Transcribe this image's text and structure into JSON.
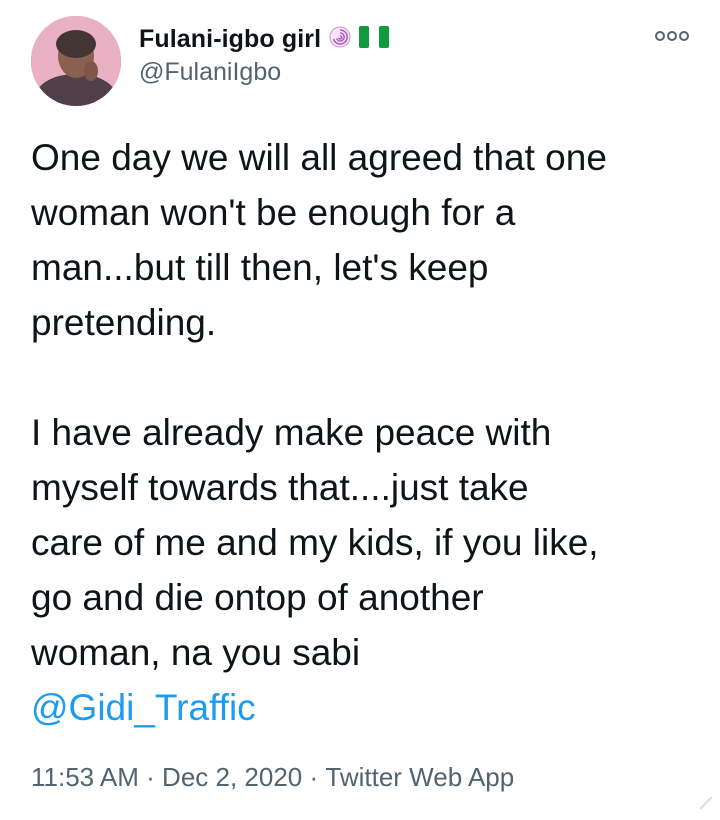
{
  "author": {
    "display_name": "Fulani-igbo girl",
    "handle": "@FulaniIgbo",
    "badges": [
      "cyclone-emoji-icon",
      "nigeria-flag-icon"
    ]
  },
  "tweet": {
    "paragraph_1": "One day we will all agreed that one\nwoman won't be enough for a\nman...but till then, let's keep\npretending.",
    "paragraph_2": "I have already make peace with\nmyself towards that....just take\ncare of me and my kids, if you like,\ngo and die ontop of another\nwoman, na you sabi",
    "mention": "@Gidi_Traffic"
  },
  "meta": {
    "time": "11:53 AM",
    "separator": " · ",
    "date": "Dec 2, 2020",
    "source": "Twitter Web App"
  },
  "colors": {
    "text": "#0f1419",
    "secondary": "#536471",
    "link": "#1d9bf0"
  }
}
